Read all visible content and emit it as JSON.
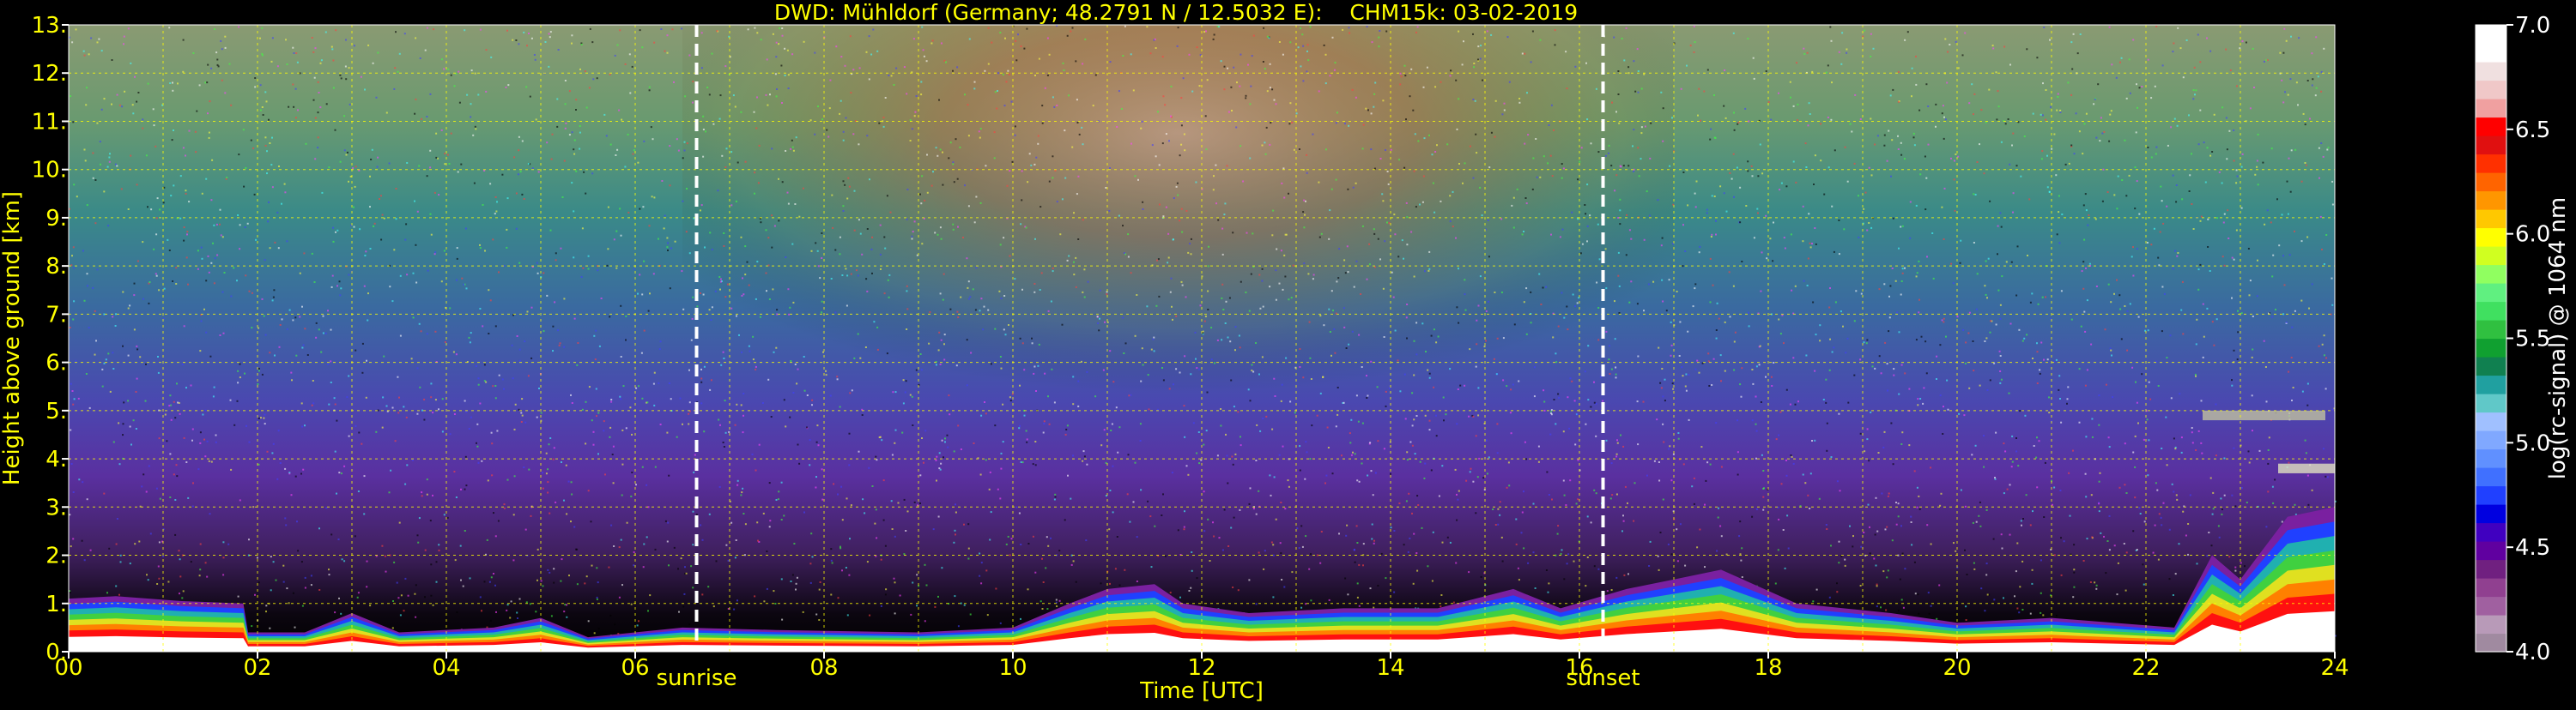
{
  "chart_data": {
    "type": "heatmap",
    "title": "DWD: Mühldorf (Germany; 48.2791 N / 12.5032 E):    CHM15k: 03-02-2019",
    "xlabel": "Time [UTC]",
    "ylabel": "Height above ground [km]",
    "x_ticks": [
      "00",
      "02",
      "04",
      "06",
      "08",
      "10",
      "12",
      "14",
      "16",
      "18",
      "20",
      "22",
      "24"
    ],
    "y_ticks": [
      "0.",
      "1.",
      "2.",
      "3.",
      "4.",
      "5.",
      "6.",
      "7.",
      "8.",
      "9.",
      "10.",
      "11.",
      "12.",
      "13."
    ],
    "xlim": [
      0,
      24
    ],
    "ylim": [
      0,
      13
    ],
    "grid": true,
    "annotations": [
      {
        "label": "sunrise",
        "x": 6.65
      },
      {
        "label": "sunset",
        "x": 16.25
      }
    ],
    "colorbar": {
      "label": "log(rc-signal) @ 1064 nm",
      "ticks": [
        "4.0",
        "4.5",
        "5.0",
        "5.5",
        "6.0",
        "6.5",
        "7.0"
      ],
      "range": [
        4.0,
        7.0
      ],
      "colors": [
        "#a08aa0",
        "#b89ab8",
        "#a060a0",
        "#904090",
        "#702080",
        "#6000a0",
        "#4000c0",
        "#0000e0",
        "#2040ff",
        "#4070ff",
        "#6090ff",
        "#80a8ff",
        "#a0c0ff",
        "#60c8c8",
        "#20a0a0",
        "#108050",
        "#10a030",
        "#30c040",
        "#40e060",
        "#60f080",
        "#90ff60",
        "#d0ff20",
        "#ffff00",
        "#ffc800",
        "#ff9600",
        "#ff6400",
        "#ff3000",
        "#e01010",
        "#ff0000",
        "#f0a0a0",
        "#f0c8c8",
        "#f0e0e0",
        "#ffffff",
        "#ffffff"
      ]
    }
  }
}
